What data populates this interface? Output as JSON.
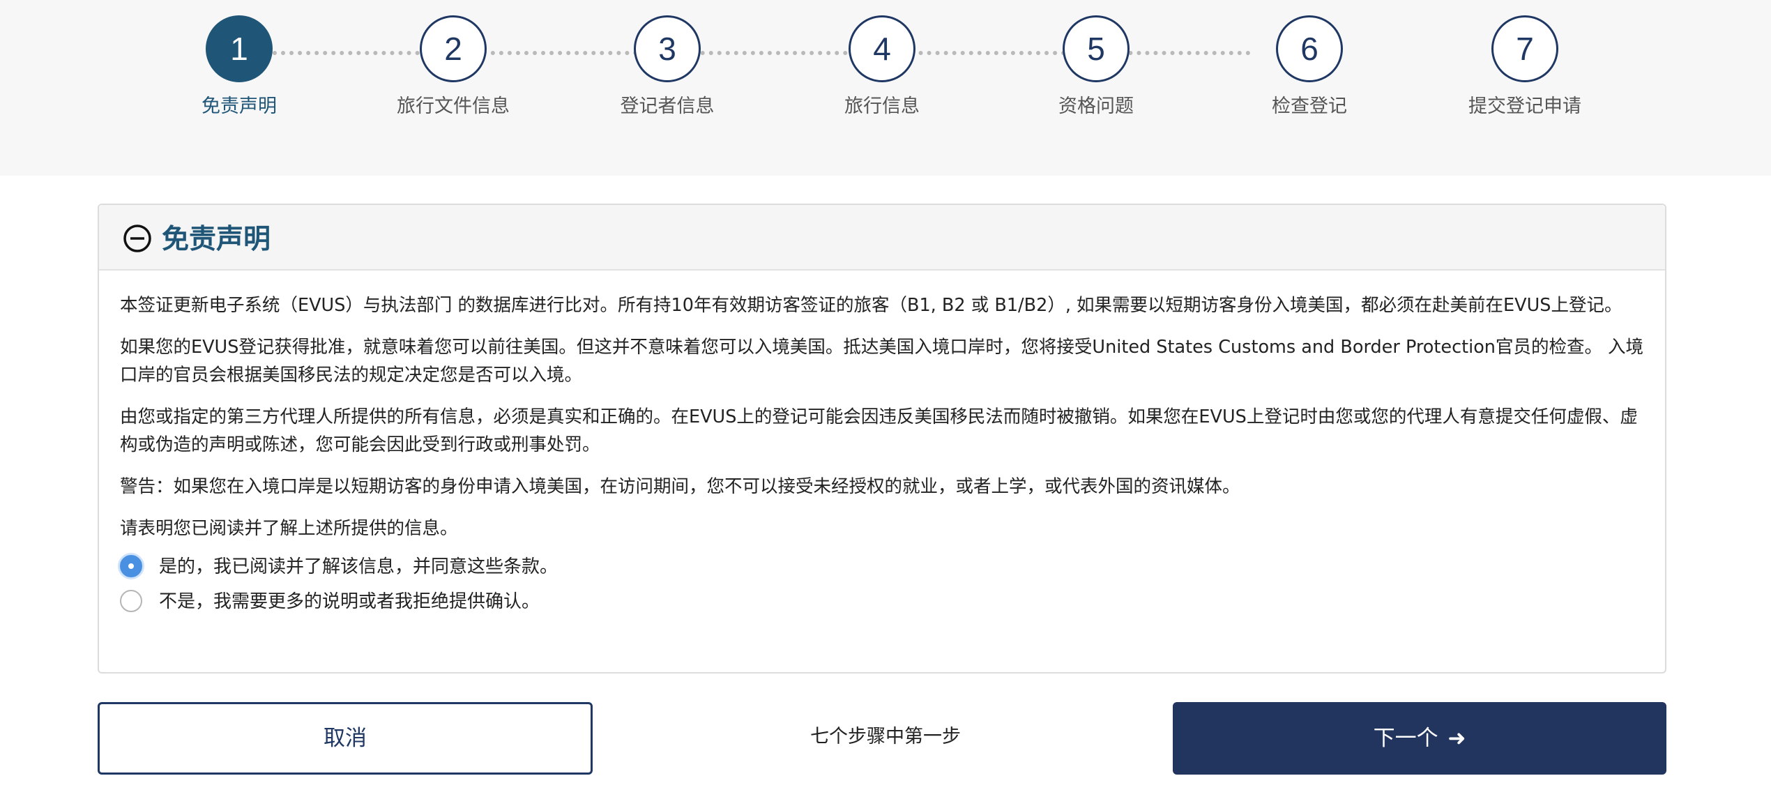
{
  "stepper": {
    "steps": [
      {
        "number": "1",
        "label": "免责声明"
      },
      {
        "number": "2",
        "label": "旅行文件信息"
      },
      {
        "number": "3",
        "label": "登记者信息"
      },
      {
        "number": "4",
        "label": "旅行信息"
      },
      {
        "number": "5",
        "label": "资格问题"
      },
      {
        "number": "6",
        "label": "检查登记"
      },
      {
        "number": "7",
        "label": "提交登记申请"
      }
    ],
    "active_step": 1,
    "colors": {
      "active": "#1f5678",
      "inactive_border": "#1f3763"
    }
  },
  "panel": {
    "title": "免责声明",
    "icon": "minus-circle-icon",
    "paragraphs": [
      "本签证更新电子系统（EVUS）与执法部门 的数据库进行比对。所有持10年有效期访客签证的旅客（B1, B2 或 B1/B2）, 如果需要以短期访客身份入境美国，都必须在赴美前在EVUS上登记。",
      "如果您的EVUS登记获得批准，就意味着您可以前往美国。但这并不意味着您可以入境美国。抵达美国入境口岸时，您将接受United States Customs and Border Protection官员的检查。 入境口岸的官员会根据美国移民法的规定决定您是否可以入境。",
      "由您或指定的第三方代理人所提供的所有信息，必须是真实和正确的。在EVUS上的登记可能会因违反美国移民法而随时被撤销。如果您在EVUS上登记时由您或您的代理人有意提交任何虚假、虚构或伪造的声明或陈述，您可能会因此受到行政或刑事处罚。",
      "警告：如果您在入境口岸是以短期访客的身份申请入境美国，在访问期间，您不可以接受未经授权的就业，或者上学，或代表外国的资讯媒体。",
      "请表明您已阅读并了解上述所提供的信息。"
    ],
    "options": [
      {
        "label": "是的，我已阅读并了解该信息，并同意这些条款。",
        "checked": true
      },
      {
        "label": "不是，我需要更多的说明或者我拒绝提供确认。",
        "checked": false
      }
    ]
  },
  "footer": {
    "cancel_label": "取消",
    "step_count": "七个步骤中第一步",
    "next_label": "下一个",
    "next_icon": "arrow-right-icon",
    "colors": {
      "primary": "#22355f"
    }
  }
}
